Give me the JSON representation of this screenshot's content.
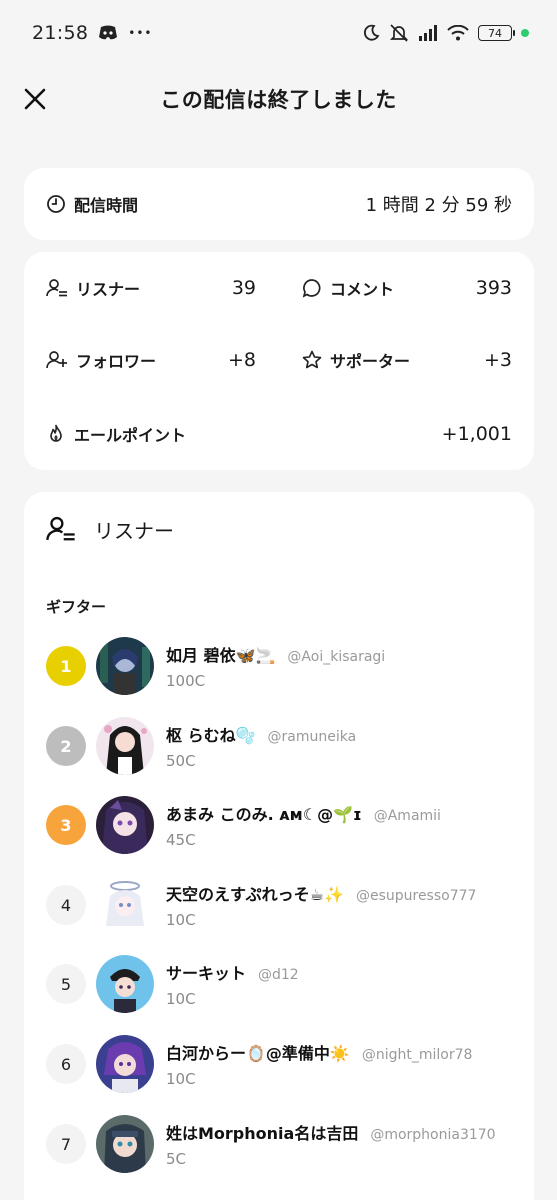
{
  "status_bar": {
    "time": "21:58",
    "dots": "•••",
    "battery": "74",
    "icons": [
      "discord-icon",
      "moon-icon",
      "mute-icon",
      "signal-icon",
      "wifi-icon",
      "battery-icon"
    ],
    "dot_color": "#2ecc71"
  },
  "header": {
    "title": "この配信は終了しました",
    "close_icon": "close-icon"
  },
  "duration": {
    "label": "配信時間",
    "value": "1 時間 2 分 59 秒",
    "icon": "clock-icon"
  },
  "stats": {
    "listeners": {
      "label": "リスナー",
      "value": "39",
      "icon": "person-list-icon"
    },
    "comments": {
      "label": "コメント",
      "value": "393",
      "icon": "speech-bubble-icon"
    },
    "followers": {
      "label": "フォロワー",
      "value": "+8",
      "icon": "person-add-icon"
    },
    "supporters": {
      "label": "サポーター",
      "value": "+3",
      "icon": "star-icon"
    },
    "yell_points": {
      "label": "エールポイント",
      "value": "+1,001",
      "icon": "flame-icon"
    }
  },
  "listeners_section": {
    "title": "リスナー",
    "icon": "person-list-icon",
    "gifters_label": "ギフター",
    "gifters": [
      {
        "rank": "1",
        "name": "如月 碧依🦋🚬",
        "handle": "@Aoi_kisaragi",
        "coins": "100C",
        "badge_color": "#e8cf00"
      },
      {
        "rank": "2",
        "name": "枢 らむね🫧",
        "handle": "@ramuneika",
        "coins": "50C",
        "badge_color": "#bdbdbd"
      },
      {
        "rank": "3",
        "name": "あまみ このみ. ᴀᴍ☾@🌱ɪ",
        "handle": "@Amamii",
        "coins": "45C",
        "badge_color": "#f7a43c"
      },
      {
        "rank": "4",
        "name": "天空のえすぷれっそ☕✨",
        "handle": "@esupuresso777",
        "coins": "10C",
        "badge_color": "#f3f3f3"
      },
      {
        "rank": "5",
        "name": "サーキット",
        "handle": "@d12",
        "coins": "10C",
        "badge_color": "#f3f3f3"
      },
      {
        "rank": "6",
        "name": "白河からー🪞@準備中☀️",
        "handle": "@night_milor78",
        "coins": "10C",
        "badge_color": "#f3f3f3"
      },
      {
        "rank": "7",
        "name": "姓はMorphonia名は吉田",
        "handle": "@morphonia3170",
        "coins": "5C",
        "badge_color": "#f3f3f3"
      }
    ]
  }
}
